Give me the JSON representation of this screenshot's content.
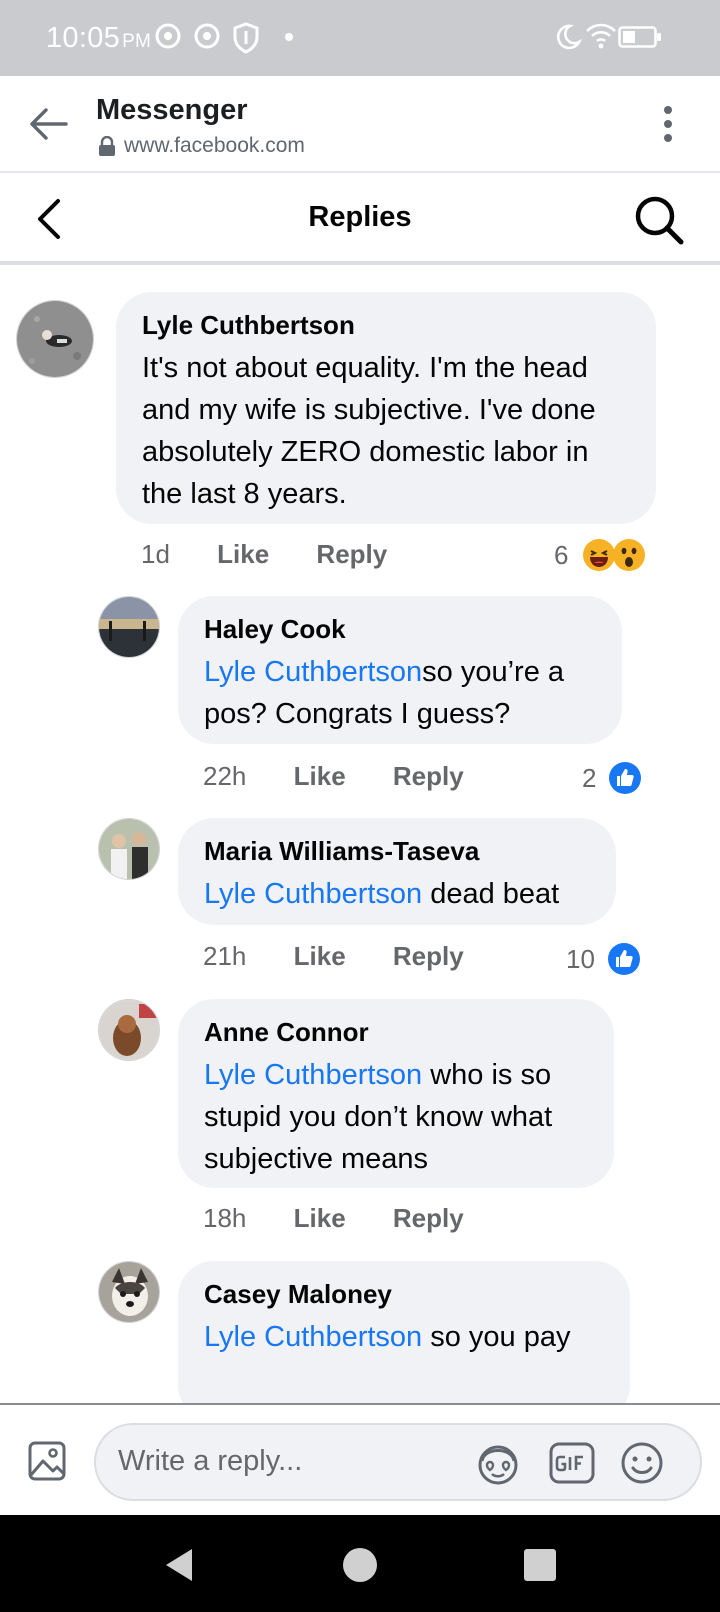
{
  "status_bar": {
    "time": "10:05",
    "ampm": "PM"
  },
  "browser": {
    "title": "Messenger",
    "url": "www.facebook.com"
  },
  "header": {
    "title": "Replies"
  },
  "comments": [
    {
      "author": "Lyle Cuthbertson",
      "mention": "",
      "text": "It's not about equality. I'm the head and my wife is subjective. I've done absolutely ZERO domestic labor in the last 8 years.",
      "time": "1d",
      "like": "Like",
      "reply": "Reply",
      "reaction_count": "6",
      "reactions": [
        "haha",
        "wow"
      ]
    },
    {
      "author": "Haley Cook",
      "mention": "Lyle Cuthbertson",
      "text": "so you’re a pos? Congrats I guess?",
      "time": "22h",
      "like": "Like",
      "reply": "Reply",
      "reaction_count": "2",
      "reactions": [
        "like"
      ]
    },
    {
      "author": "Maria Williams-Taseva",
      "mention": "Lyle Cuthbertson",
      "text": " dead beat",
      "time": "21h",
      "like": "Like",
      "reply": "Reply",
      "reaction_count": "10",
      "reactions": [
        "like"
      ]
    },
    {
      "author": "Anne Connor",
      "mention": "Lyle Cuthbertson",
      "text": " who is so stupid you don’t know what subjective means",
      "time": "18h",
      "like": "Like",
      "reply": "Reply",
      "reaction_count": "",
      "reactions": []
    },
    {
      "author": "Casey Maloney",
      "mention": "Lyle Cuthbertson",
      "text": " so you pay",
      "time": "",
      "like": "",
      "reply": "",
      "reaction_count": "",
      "reactions": []
    }
  ],
  "composer": {
    "placeholder": "Write a reply..."
  },
  "colors": {
    "accent": "#1877f2",
    "bubble": "#f0f2f5",
    "status_bar": "#c9cbce"
  },
  "icons": [
    "arrow-left-icon",
    "lock-icon",
    "more-vertical-icon",
    "chevron-left-icon",
    "search-icon",
    "photo-icon",
    "avatar-sticker-icon",
    "gif-icon",
    "emoji-icon"
  ]
}
